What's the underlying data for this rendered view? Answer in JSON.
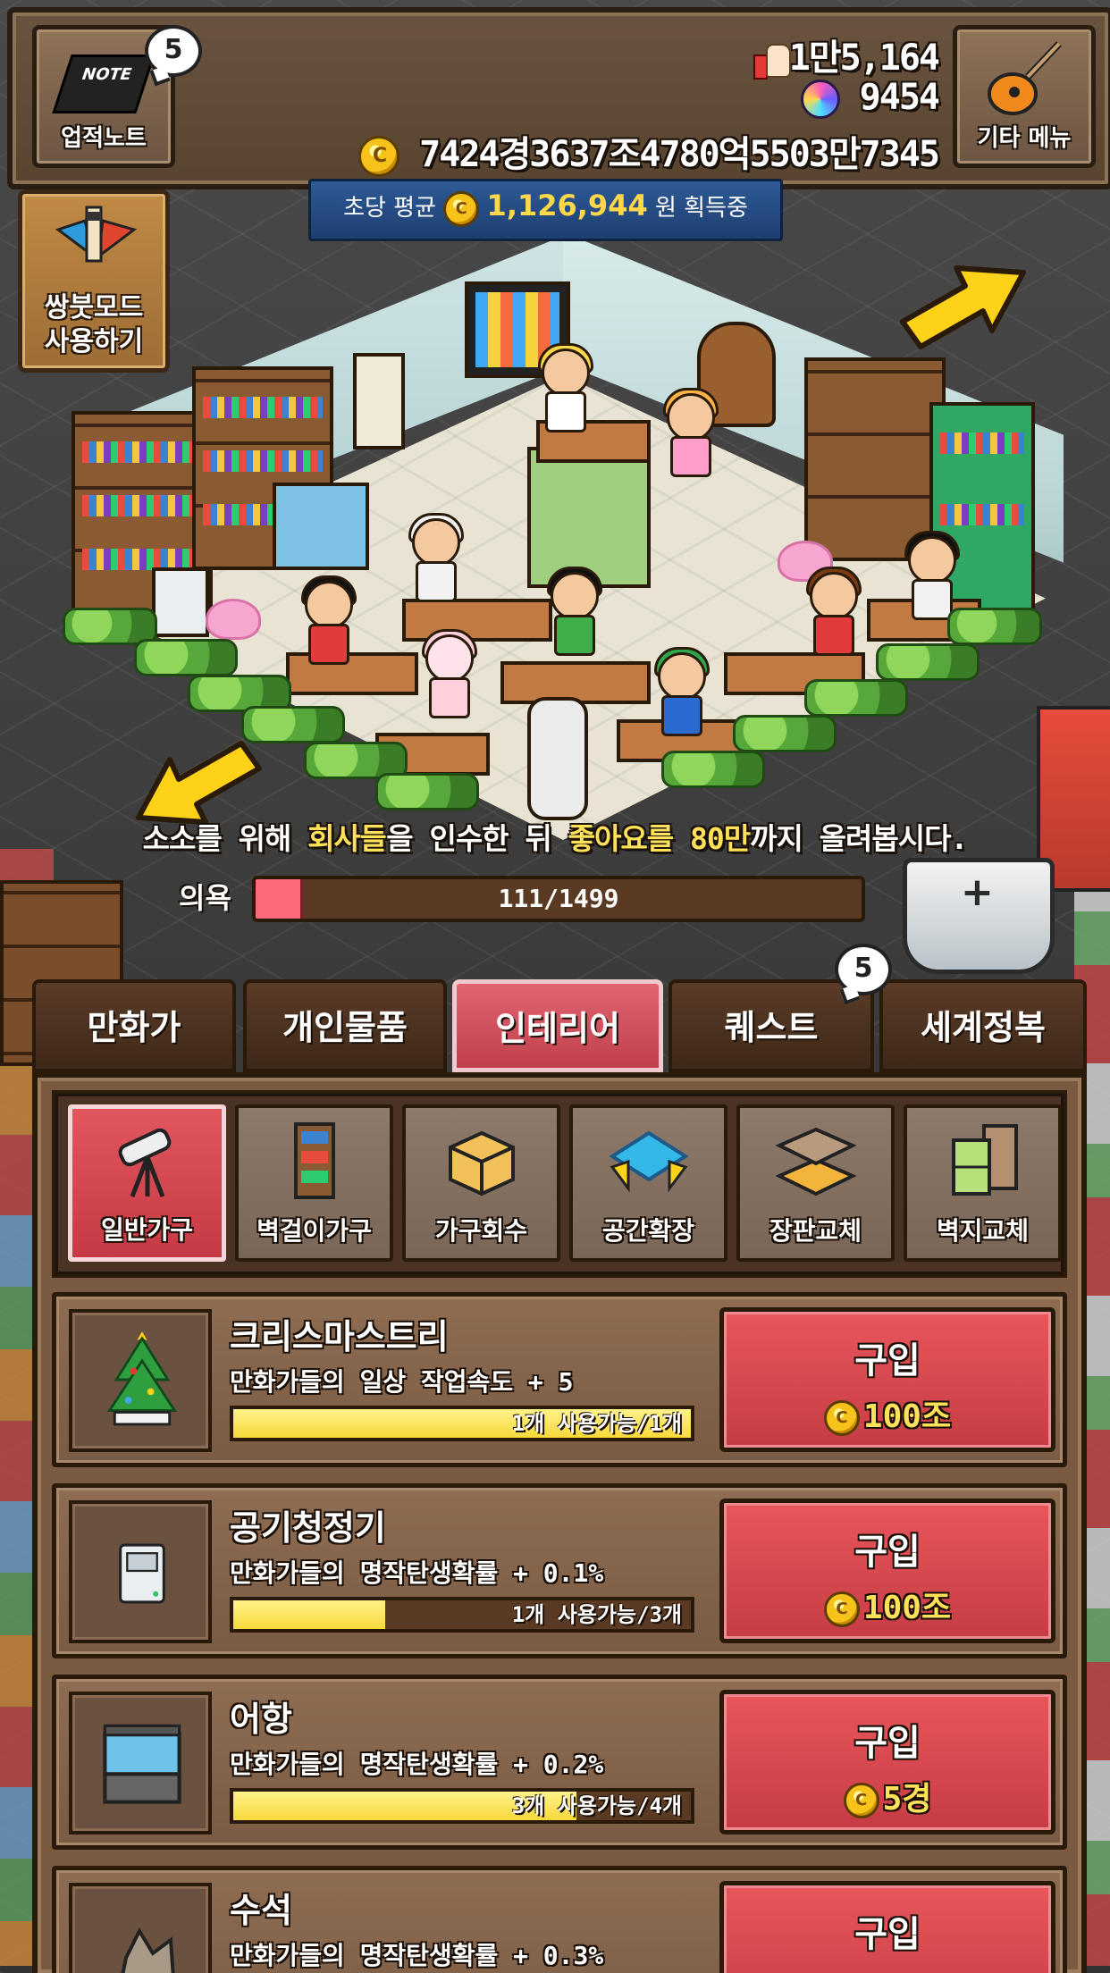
{
  "header": {
    "achievement_note": {
      "label": "업적노트",
      "icon": "notebook-icon",
      "badge": "5",
      "note_text": "NOTE"
    },
    "likes": "1만5,164",
    "gems": "9454",
    "coins": "7424경3637조4780억5503만7345",
    "coin_symbol": "C",
    "other_menu": {
      "label": "기타 메뉴",
      "icon": "guitar-icon"
    }
  },
  "income": {
    "prefix": "초당 평균",
    "value": "1,126,944",
    "suffix": "원 획득중"
  },
  "ssangbut_mode": {
    "line1": "쌍붓모드",
    "line2": "사용하기",
    "icon": "brush-icon"
  },
  "quest": {
    "parts": [
      "소소를 위해 ",
      "회사들",
      "을 인수한 뒤 ",
      "좋아요를 80만",
      "까지 올려봅시다."
    ]
  },
  "motivation": {
    "label": "의욕",
    "current": 111,
    "max": 1499,
    "text": "111/1499"
  },
  "tabs": [
    {
      "label": "만화가",
      "active": false
    },
    {
      "label": "개인물품",
      "active": false
    },
    {
      "label": "인테리어",
      "active": true
    },
    {
      "label": "퀘스트",
      "active": false,
      "badge": "5"
    },
    {
      "label": "세계정복",
      "active": false
    }
  ],
  "subtabs": [
    {
      "label": "일반가구",
      "icon": "telescope-icon",
      "active": true
    },
    {
      "label": "벽걸이가구",
      "icon": "bookshelf-icon",
      "active": false
    },
    {
      "label": "가구회수",
      "icon": "crate-icon",
      "active": false
    },
    {
      "label": "공간확장",
      "icon": "floor-expand-icon",
      "active": false
    },
    {
      "label": "장판교체",
      "icon": "floor-tile-icon",
      "active": false
    },
    {
      "label": "벽지교체",
      "icon": "wallpaper-icon",
      "active": false
    }
  ],
  "items": [
    {
      "name": "크리스마스트리",
      "desc": "만화가들의 일상 작업속도 + 5",
      "stock": "1개 사용가능/1개",
      "fill": 1.0,
      "buy": "구입",
      "price": "100조",
      "icon": "christmas-tree-icon"
    },
    {
      "name": "공기청정기",
      "desc": "만화가들의 명작탄생확률 + 0.1%",
      "stock": "1개 사용가능/3개",
      "fill": 0.333,
      "buy": "구입",
      "price": "100조",
      "icon": "air-purifier-icon"
    },
    {
      "name": "어항",
      "desc": "만화가들의 명작탄생확률 + 0.2%",
      "stock": "3개 사용가능/4개",
      "fill": 0.75,
      "buy": "구입",
      "price": "5경",
      "icon": "aquarium-icon"
    },
    {
      "name": "수석",
      "desc": "만화가들의 명작탄생확률 + 0.3%",
      "stock": "",
      "fill": 0,
      "buy": "구입",
      "price": "",
      "icon": "stone-icon"
    }
  ],
  "colors": {
    "accent_red": "#c63c44",
    "gold": "#ffd84a",
    "panel_brown": "#7a5a40"
  }
}
